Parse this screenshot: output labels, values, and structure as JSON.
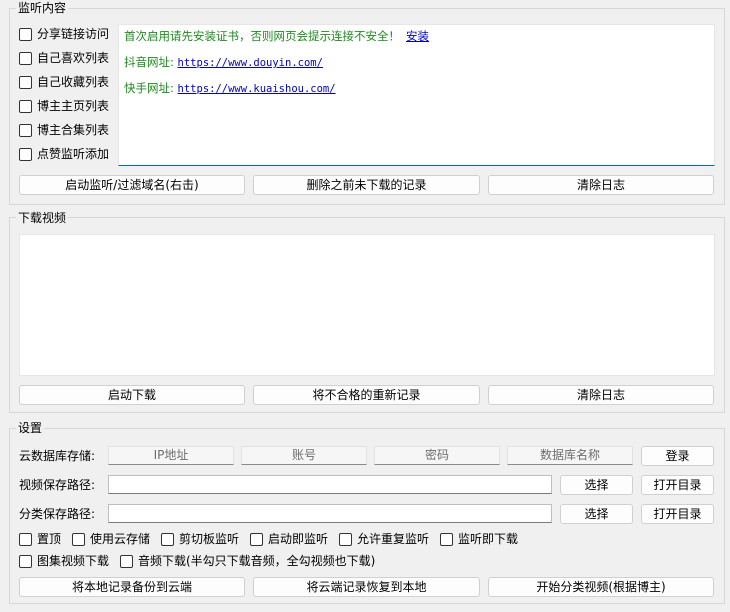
{
  "monitor": {
    "title": "监听内容",
    "options": [
      {
        "label": "分享链接访问",
        "checked": false
      },
      {
        "label": "自己喜欢列表",
        "checked": false
      },
      {
        "label": "自己收藏列表",
        "checked": false
      },
      {
        "label": "博主主页列表",
        "checked": false
      },
      {
        "label": "博主合集列表",
        "checked": false
      },
      {
        "label": "点赞监听添加",
        "checked": false
      }
    ],
    "log": {
      "line1_text": "首次启用请先安装证书，否则网页会提示连接不安全！",
      "line1_link": "安装",
      "line2_label": "抖音网址:",
      "line2_url": "https://www.douyin.com/",
      "line3_label": "快手网址:",
      "line3_url": "https://www.kuaishou.com/"
    },
    "buttons": {
      "start": "启动监听/过滤域名(右击)",
      "delete": "删除之前未下载的记录",
      "clear": "清除日志"
    }
  },
  "download": {
    "title": "下载视频",
    "buttons": {
      "start": "启动下载",
      "rerecord": "将不合格的重新记录",
      "clear": "清除日志"
    }
  },
  "settings": {
    "title": "设置",
    "cloud_label": "云数据库存储:",
    "ip_placeholder": "IP地址",
    "account_placeholder": "账号",
    "password_placeholder": "密码",
    "dbname_placeholder": "数据库名称",
    "login": "登录",
    "video_path_label": "视频保存路径:",
    "category_path_label": "分类保存路径:",
    "choose": "选择",
    "open_dir": "打开目录",
    "options_row1": [
      {
        "label": "置顶",
        "checked": false
      },
      {
        "label": "使用云存储",
        "checked": false
      },
      {
        "label": "剪切板监听",
        "checked": false
      },
      {
        "label": "启动即监听",
        "checked": false
      },
      {
        "label": "允许重复监听",
        "checked": false
      },
      {
        "label": "监听即下载",
        "checked": false
      }
    ],
    "options_row2": [
      {
        "label": "图集视频下载",
        "checked": false
      },
      {
        "label": "音频下载(半勾只下载音频，全勾视频也下载)",
        "checked": false
      }
    ],
    "buttons": {
      "backup": "将本地记录备份到云端",
      "restore": "将云端记录恢复到本地",
      "classify": "开始分类视频(根据博主)"
    }
  }
}
